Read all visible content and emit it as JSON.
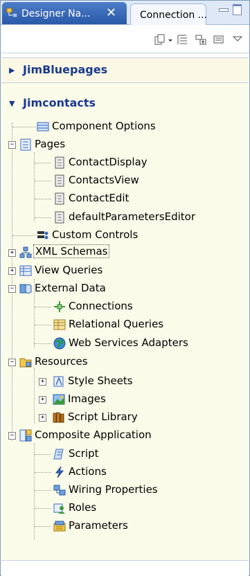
{
  "tabs": [
    {
      "label": "Designer Na...",
      "active": true,
      "close": "✕"
    },
    {
      "label": "Connection ...",
      "active": false
    }
  ],
  "toolbar_icons": [
    "new-icon",
    "dropdown-arrow-icon",
    "collapse-icon",
    "expand-icon",
    "filter-icon",
    "view-menu-icon"
  ],
  "sections": {
    "collapsed": {
      "title": "JimBluepages"
    },
    "expanded": {
      "title": "Jimcontacts"
    }
  },
  "tree": [
    {
      "label": "Component Options"
    },
    {
      "label": "Pages"
    },
    {
      "label": "ContactDisplay"
    },
    {
      "label": "ContactsView"
    },
    {
      "label": "ContactEdit"
    },
    {
      "label": "defaultParametersEditor"
    },
    {
      "label": "Custom Controls"
    },
    {
      "label": "XML Schemas"
    },
    {
      "label": "View Queries"
    },
    {
      "label": "External Data"
    },
    {
      "label": "Connections"
    },
    {
      "label": "Relational Queries"
    },
    {
      "label": "Web Services Adapters"
    },
    {
      "label": "Resources"
    },
    {
      "label": "Style Sheets"
    },
    {
      "label": "Images"
    },
    {
      "label": "Script Library"
    },
    {
      "label": "Composite Application"
    },
    {
      "label": "Script"
    },
    {
      "label": "Actions"
    },
    {
      "label": "Wiring Properties"
    },
    {
      "label": "Roles"
    },
    {
      "label": "Parameters"
    }
  ],
  "colors": {
    "tab_active": "#3b6bbd",
    "section_title": "#1a3a8f",
    "section_bg": "#fbfbe9"
  }
}
